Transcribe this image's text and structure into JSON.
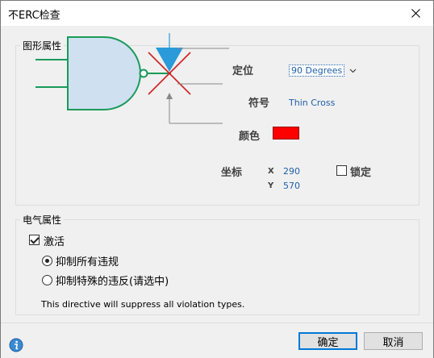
{
  "window": {
    "title": "不ERC检查"
  },
  "graphic_group": {
    "legend": "图形属性",
    "position_label": "定位",
    "position_value": "90 Degrees",
    "symbol_label": "符号",
    "symbol_value": "Thin Cross",
    "color_label": "颜色",
    "color_hex": "#ff0000",
    "coords_label": "坐标",
    "x_axis": "X",
    "x_value": "290",
    "y_axis": "Y",
    "y_value": "570",
    "lock_label": "锁定",
    "lock_checked": false
  },
  "electrical_group": {
    "legend": "电气属性",
    "active_label": "激活",
    "active_checked": true,
    "radio_all_label": "抑制所有违规",
    "radio_specific_label": "抑制特殊的违反(请选中)",
    "selected_radio": "all",
    "description": "This directive will suppress all violation types."
  },
  "footer": {
    "ok_label": "确定",
    "cancel_label": "取消"
  },
  "colors": {
    "accent": "#0078d7",
    "value_text": "#1f5fa8",
    "gate_fill": "#cfe0f1",
    "gate_stroke": "#1a9a5a",
    "arrow": "#2a9ad8",
    "cross": "#d02020"
  },
  "icons": {
    "close": "close-icon",
    "info": "info-icon",
    "dropdown": "chevron-down-icon"
  }
}
